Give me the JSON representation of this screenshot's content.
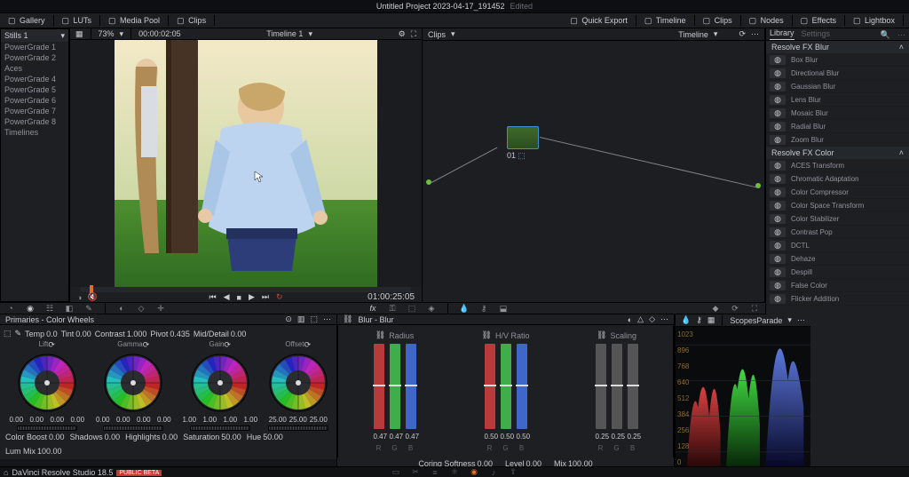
{
  "title": "Untitled Project 2023-04-17_191452",
  "editedTag": "Edited",
  "topmenu": {
    "left": [
      {
        "label": "Gallery",
        "active": true
      },
      {
        "label": "LUTs"
      },
      {
        "label": "Media Pool"
      },
      {
        "label": "Clips"
      }
    ],
    "right": [
      {
        "label": "Quick Export"
      },
      {
        "label": "Timeline"
      },
      {
        "label": "Clips"
      },
      {
        "label": "Nodes",
        "active": true
      },
      {
        "label": "Effects",
        "active": true
      },
      {
        "label": "Lightbox"
      }
    ]
  },
  "sidebar": {
    "header": "Stills 1",
    "items": [
      "PowerGrade 1",
      "PowerGrade 2",
      "Aces",
      "PowerGrade 4",
      "PowerGrade 5",
      "PowerGrade 6",
      "PowerGrade 7",
      "PowerGrade 8",
      "Timelines"
    ]
  },
  "viewer": {
    "zoom": "73%",
    "tcSmall": "00:00:02:05",
    "tlName": "Timeline 1",
    "tcBig": "01:00:25:05"
  },
  "nodes": {
    "clipLabel": "Clips",
    "tlName": "Timeline",
    "nodeLabel": "01"
  },
  "library": {
    "tabs": [
      "Library",
      "Settings"
    ],
    "groups": [
      {
        "title": "Resolve FX Blur",
        "items": [
          "Box Blur",
          "Directional Blur",
          "Gaussian Blur",
          "Lens Blur",
          "Mosaic Blur",
          "Radial Blur",
          "Zoom Blur"
        ]
      },
      {
        "title": "Resolve FX Color",
        "items": [
          "ACES Transform",
          "Chromatic Adaptation",
          "Color Compressor",
          "Color Space Transform",
          "Color Stabilizer",
          "Contrast Pop",
          "DCTL",
          "Dehaze",
          "Despill",
          "False Color",
          "Flicker Addition"
        ]
      }
    ]
  },
  "wheels": {
    "title": "Primaries - Color Wheels",
    "top": [
      {
        "l": "Temp",
        "v": "0.0"
      },
      {
        "l": "Tint",
        "v": "0.00"
      },
      {
        "l": "Contrast",
        "v": "1.000"
      },
      {
        "l": "Pivot",
        "v": "0.435"
      },
      {
        "l": "Mid/Detail",
        "v": "0.00"
      }
    ],
    "items": [
      {
        "name": "Lift",
        "vals": [
          "0.00",
          "0.00",
          "0.00",
          "0.00"
        ]
      },
      {
        "name": "Gamma",
        "vals": [
          "0.00",
          "0.00",
          "0.00",
          "0.00"
        ]
      },
      {
        "name": "Gain",
        "vals": [
          "1.00",
          "1.00",
          "1.00",
          "1.00"
        ]
      },
      {
        "name": "Offset",
        "vals": [
          "25.00",
          "25.00",
          "25.00"
        ]
      }
    ],
    "bottom": [
      {
        "l": "Color Boost",
        "v": "0.00"
      },
      {
        "l": "Shadows",
        "v": "0.00"
      },
      {
        "l": "Highlights",
        "v": "0.00"
      },
      {
        "l": "Saturation",
        "v": "50.00"
      },
      {
        "l": "Hue",
        "v": "50.00"
      },
      {
        "l": "Lum Mix",
        "v": "100.00"
      }
    ]
  },
  "blur": {
    "title": "Blur - Blur",
    "cols": [
      {
        "name": "Radius",
        "ch": [
          "R",
          "G",
          "B"
        ],
        "vals": [
          "0.47",
          "0.47",
          "0.47"
        ],
        "colors": [
          "#b83a3a",
          "#3fae4a",
          "#3f66c9"
        ]
      },
      {
        "name": "H/V Ratio",
        "ch": [
          "R",
          "G",
          "B"
        ],
        "vals": [
          "0.50",
          "0.50",
          "0.50"
        ],
        "colors": [
          "#b83a3a",
          "#3fae4a",
          "#3f66c9"
        ]
      },
      {
        "name": "Scaling",
        "ch": [
          "R",
          "G",
          "B"
        ],
        "vals": [
          "0.25",
          "0.25",
          "0.25"
        ],
        "colors": [
          "#555",
          "#555",
          "#555"
        ]
      }
    ],
    "footer": [
      {
        "l": "Coring Softness",
        "v": "0.00"
      },
      {
        "l": "Level",
        "v": "0.00"
      },
      {
        "l": "Mix",
        "v": "100.00"
      }
    ]
  },
  "scopes": {
    "title": "Scopes",
    "mode": "Parade",
    "ticks": [
      "1023",
      "896",
      "768",
      "640",
      "512",
      "384",
      "256",
      "128",
      "0"
    ]
  },
  "status": {
    "app": "DaVinci Resolve Studio 18.5",
    "badge": "PUBLIC BETA"
  }
}
